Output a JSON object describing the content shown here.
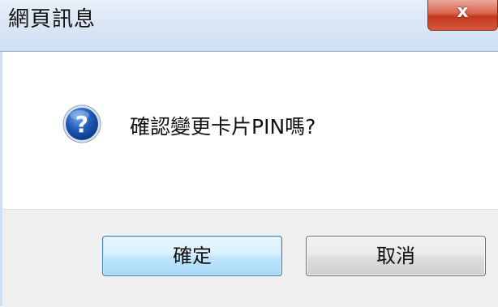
{
  "window": {
    "title": "網頁訊息",
    "close_label": "x"
  },
  "dialog": {
    "icon": "question-icon",
    "message": "確認變更卡片PIN嗎?"
  },
  "buttons": {
    "ok_label": "確定",
    "cancel_label": "取消"
  },
  "colors": {
    "titlebar": "#dbe7f5",
    "close_button": "#c3391f",
    "icon_blue": "#1f5bb8",
    "button_area": "#f0f0f0",
    "ok_border": "#3c7fb1"
  }
}
